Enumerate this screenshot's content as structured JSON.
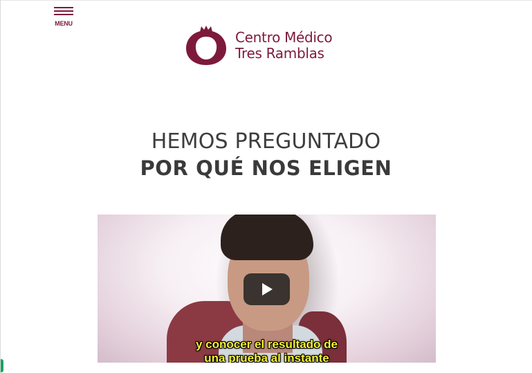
{
  "header": {
    "menu_label": "MENU",
    "logo_line1": "Centro Médico",
    "logo_line2": "Tres Ramblas",
    "brand_color": "#7d1a3b"
  },
  "hero": {
    "heading_light": "HEMOS PREGUNTADO",
    "heading_bold": "POR QUÉ NOS ELIGEN"
  },
  "video": {
    "subtitle_line1": "y conocer el resultado de",
    "subtitle_line2": "una prueba al instante",
    "play_icon": "play-icon"
  },
  "widgets": {
    "chat_color": "#1aa260"
  }
}
